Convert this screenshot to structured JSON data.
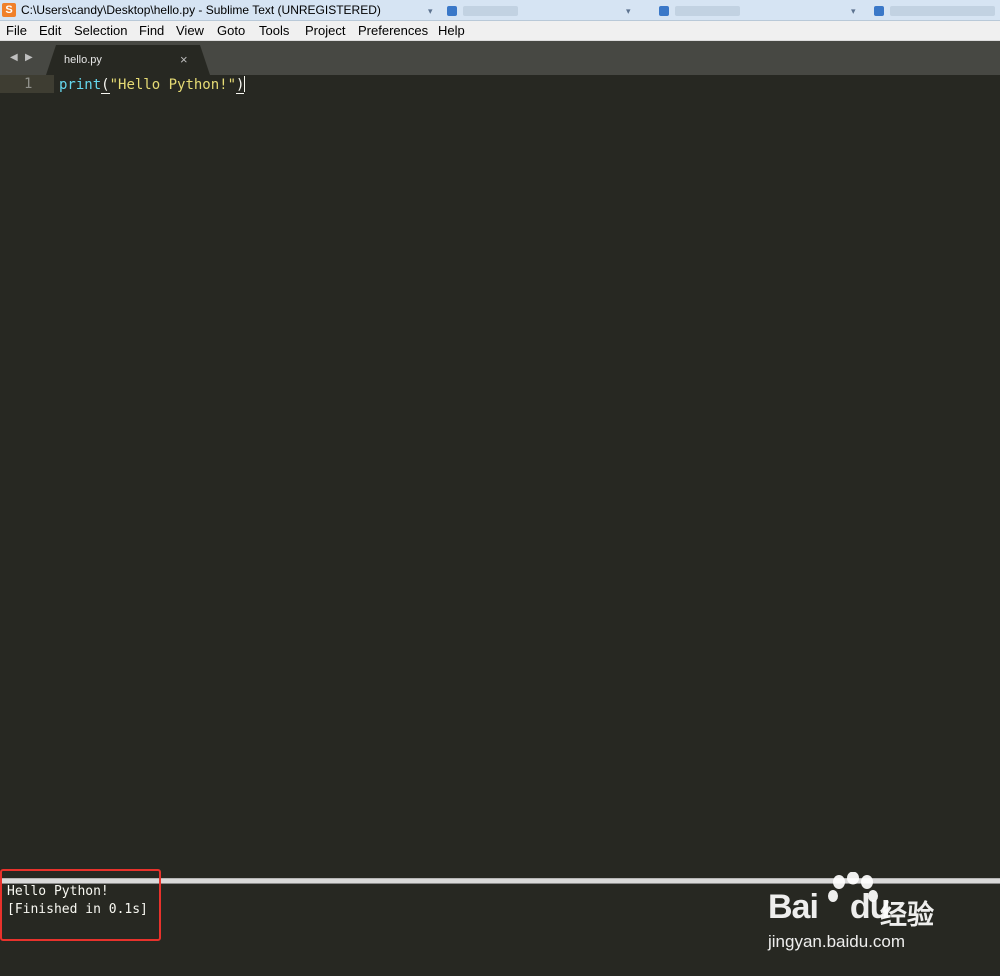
{
  "window": {
    "title": "C:\\Users\\candy\\Desktop\\hello.py - Sublime Text (UNREGISTERED)",
    "app_icon": "S",
    "accent": "#f0802a"
  },
  "menu": [
    "File",
    "Edit",
    "Selection",
    "Find",
    "View",
    "Goto",
    "Tools",
    "Project",
    "Preferences",
    "Help"
  ],
  "tabs": [
    {
      "label": "hello.py",
      "active": true,
      "close": "×"
    }
  ],
  "nav": {
    "back": "◀",
    "forward": "▶"
  },
  "editor": {
    "line_number": "1",
    "code": {
      "func": "print",
      "open": "(",
      "string": "\"Hello Python!\"",
      "close": ")"
    },
    "colors": {
      "background": "#272822",
      "keyword": "#66d9ef",
      "string": "#e6db74",
      "text": "#f8f8f2"
    }
  },
  "output": {
    "lines": [
      "Hello Python!",
      "[Finished in 0.1s]"
    ],
    "highlight_color": "#e8322c"
  },
  "watermark": {
    "brand": "Bai",
    "brand2": "du",
    "cn": "经验",
    "url": "jingyan.baidu.com"
  }
}
